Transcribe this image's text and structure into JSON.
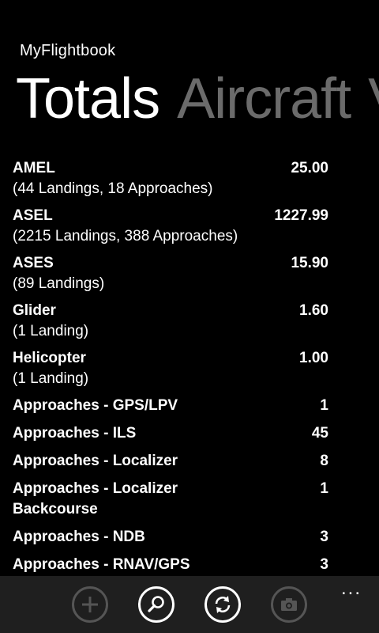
{
  "app": {
    "title": "MyFlightbook"
  },
  "pivot": {
    "active": "Totals",
    "next": "Aircraft",
    "next2": "V"
  },
  "totals": [
    {
      "label": "AMEL",
      "value": "25.00",
      "sub": "(44 Landings, 18 Approaches)"
    },
    {
      "label": "ASEL",
      "value": "1227.99",
      "sub": "(2215 Landings, 388 Approaches)"
    },
    {
      "label": "ASES",
      "value": "15.90",
      "sub": "(89 Landings)"
    },
    {
      "label": "Glider",
      "value": "1.60",
      "sub": "(1 Landing)"
    },
    {
      "label": "Helicopter",
      "value": "1.00",
      "sub": "(1 Landing)"
    },
    {
      "label": "Approaches - GPS/LPV",
      "value": "1"
    },
    {
      "label": "Approaches - ILS",
      "value": "45"
    },
    {
      "label": "Approaches - Localizer",
      "value": "8"
    },
    {
      "label": "Approaches - Localizer Backcourse",
      "value": "1"
    },
    {
      "label": "Approaches - NDB",
      "value": "3"
    },
    {
      "label": "Approaches - RNAV/GPS",
      "value": "3"
    }
  ],
  "appbar": {
    "more": "...",
    "buttons": [
      "add-icon",
      "search-icon",
      "refresh-icon",
      "camera-icon"
    ]
  }
}
